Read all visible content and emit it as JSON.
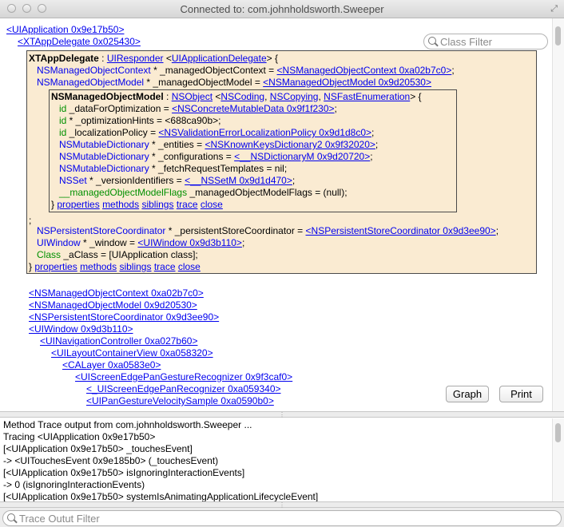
{
  "window": {
    "title": "Connected to: com.johnholdsworth.Sweeper"
  },
  "class_filter": {
    "placeholder": "Class Filter"
  },
  "trace_filter": {
    "placeholder": "Trace Outut Filter"
  },
  "buttons": {
    "graph": "Graph",
    "print": "Print"
  },
  "tree": {
    "app": "<UIApplication 0x9e17b50>",
    "delegate": "<XTAppDelegate 0x025430>"
  },
  "outer": {
    "header_class": "XTAppDelegate",
    "header_colon": " : ",
    "super": "UIResponder",
    "proto_open": " <",
    "proto": "UIApplicationDelegate",
    "proto_close": "> {",
    "ivars": [
      {
        "type": "NSManagedObjectContext",
        "decl": " * _managedObjectContext = ",
        "value": "<NSManagedObjectContext 0xa02b7c0>",
        "tail": ";"
      },
      {
        "type": "NSManagedObjectModel",
        "decl": " * _managedObjectModel = ",
        "value": "<NSManagedObjectModel 0x9d20530>",
        "tail": ""
      }
    ],
    "semicolon": ";",
    "ivars2": [
      {
        "type": "NSPersistentStoreCoordinator",
        "decl": " * _persistentStoreCoordinator = ",
        "value": "<NSPersistentStoreCoordinator 0x9d3ee90>",
        "tail": ";"
      },
      {
        "type": "UIWindow",
        "decl": " * _window = ",
        "value": "<UIWindow 0x9d3b110>",
        "tail": ";"
      },
      {
        "type": "Class",
        "decl": " _aClass = [UIApplication class];",
        "value": "",
        "tail": ""
      }
    ],
    "footer_brace": "} ",
    "links": [
      "properties",
      "methods",
      "siblings",
      "trace",
      "close"
    ]
  },
  "inner": {
    "header_class": "NSManagedObjectModel",
    "header_colon": " : ",
    "super": "NSObject",
    "proto_open": " <",
    "protos": [
      "NSCoding",
      "NSCopying",
      "NSFastEnumeration"
    ],
    "proto_close": "> {",
    "ivars": [
      {
        "type": "id",
        "decl": " _dataForOptimization = ",
        "value": "<NSConcreteMutableData 0x9f1f230>",
        "tail": ";"
      },
      {
        "type": "id",
        "decl": " * _optimizationHints = <688ca90b>;",
        "value": "",
        "tail": ""
      },
      {
        "type": "id",
        "decl": " _localizationPolicy = ",
        "value": "<NSValidationErrorLocalizationPolicy 0x9d1d8c0>",
        "tail": ";"
      },
      {
        "type": "NSMutableDictionary",
        "decl": " * _entities = ",
        "value": "<NSKnownKeysDictionary2 0x9f32020>",
        "tail": ";"
      },
      {
        "type": "NSMutableDictionary",
        "decl": " * _configurations = ",
        "value": "<__NSDictionaryM 0x9d20720>",
        "tail": ";"
      },
      {
        "type": "NSMutableDictionary",
        "decl": " * _fetchRequestTemplates = nil;",
        "value": "",
        "tail": ""
      },
      {
        "type": "NSSet",
        "decl": " * _versionIdentifiers = ",
        "value": "<__NSSetM 0x9d1d470>",
        "tail": ";"
      },
      {
        "type": "__managedObjectModelFlags",
        "decl": " _managedObjectModelFlags = (null);",
        "value": "",
        "tail": ""
      }
    ],
    "footer_brace": "} ",
    "links": [
      "properties",
      "methods",
      "siblings",
      "trace",
      "close"
    ]
  },
  "children": [
    "<NSManagedObjectContext 0xa02b7c0>",
    "<NSManagedObjectModel 0x9d20530>",
    "<NSPersistentStoreCoordinator 0x9d3ee90>",
    "<UIWindow 0x9d3b110>",
    "<UINavigationController 0xa027b60>",
    "<UILayoutContainerView 0xa058320>",
    "<CALayer 0xa0583e0>",
    "<UIScreenEdgePanGestureRecognizer 0x9f3caf0>",
    "<_UIScreenEdgePanRecognizer 0xa059340>",
    "<UIPanGestureVelocitySample 0xa0590b0>"
  ],
  "trace_lines": [
    "Method Trace output from com.johnholdsworth.Sweeper ...",
    "Tracing <UIApplication 0x9e17b50>",
    "[<UIApplication 0x9e17b50> _touchesEvent]",
    "-> <UITouchesEvent 0x9e185b0> (_touchesEvent)",
    "[<UIApplication 0x9e17b50> isIgnoringInteractionEvents]",
    "-> 0 (isIgnoringInteractionEvents)",
    "[<UIApplication 0x9e17b50> systemIsAnimatingApplicationLifecycleEvent]"
  ]
}
